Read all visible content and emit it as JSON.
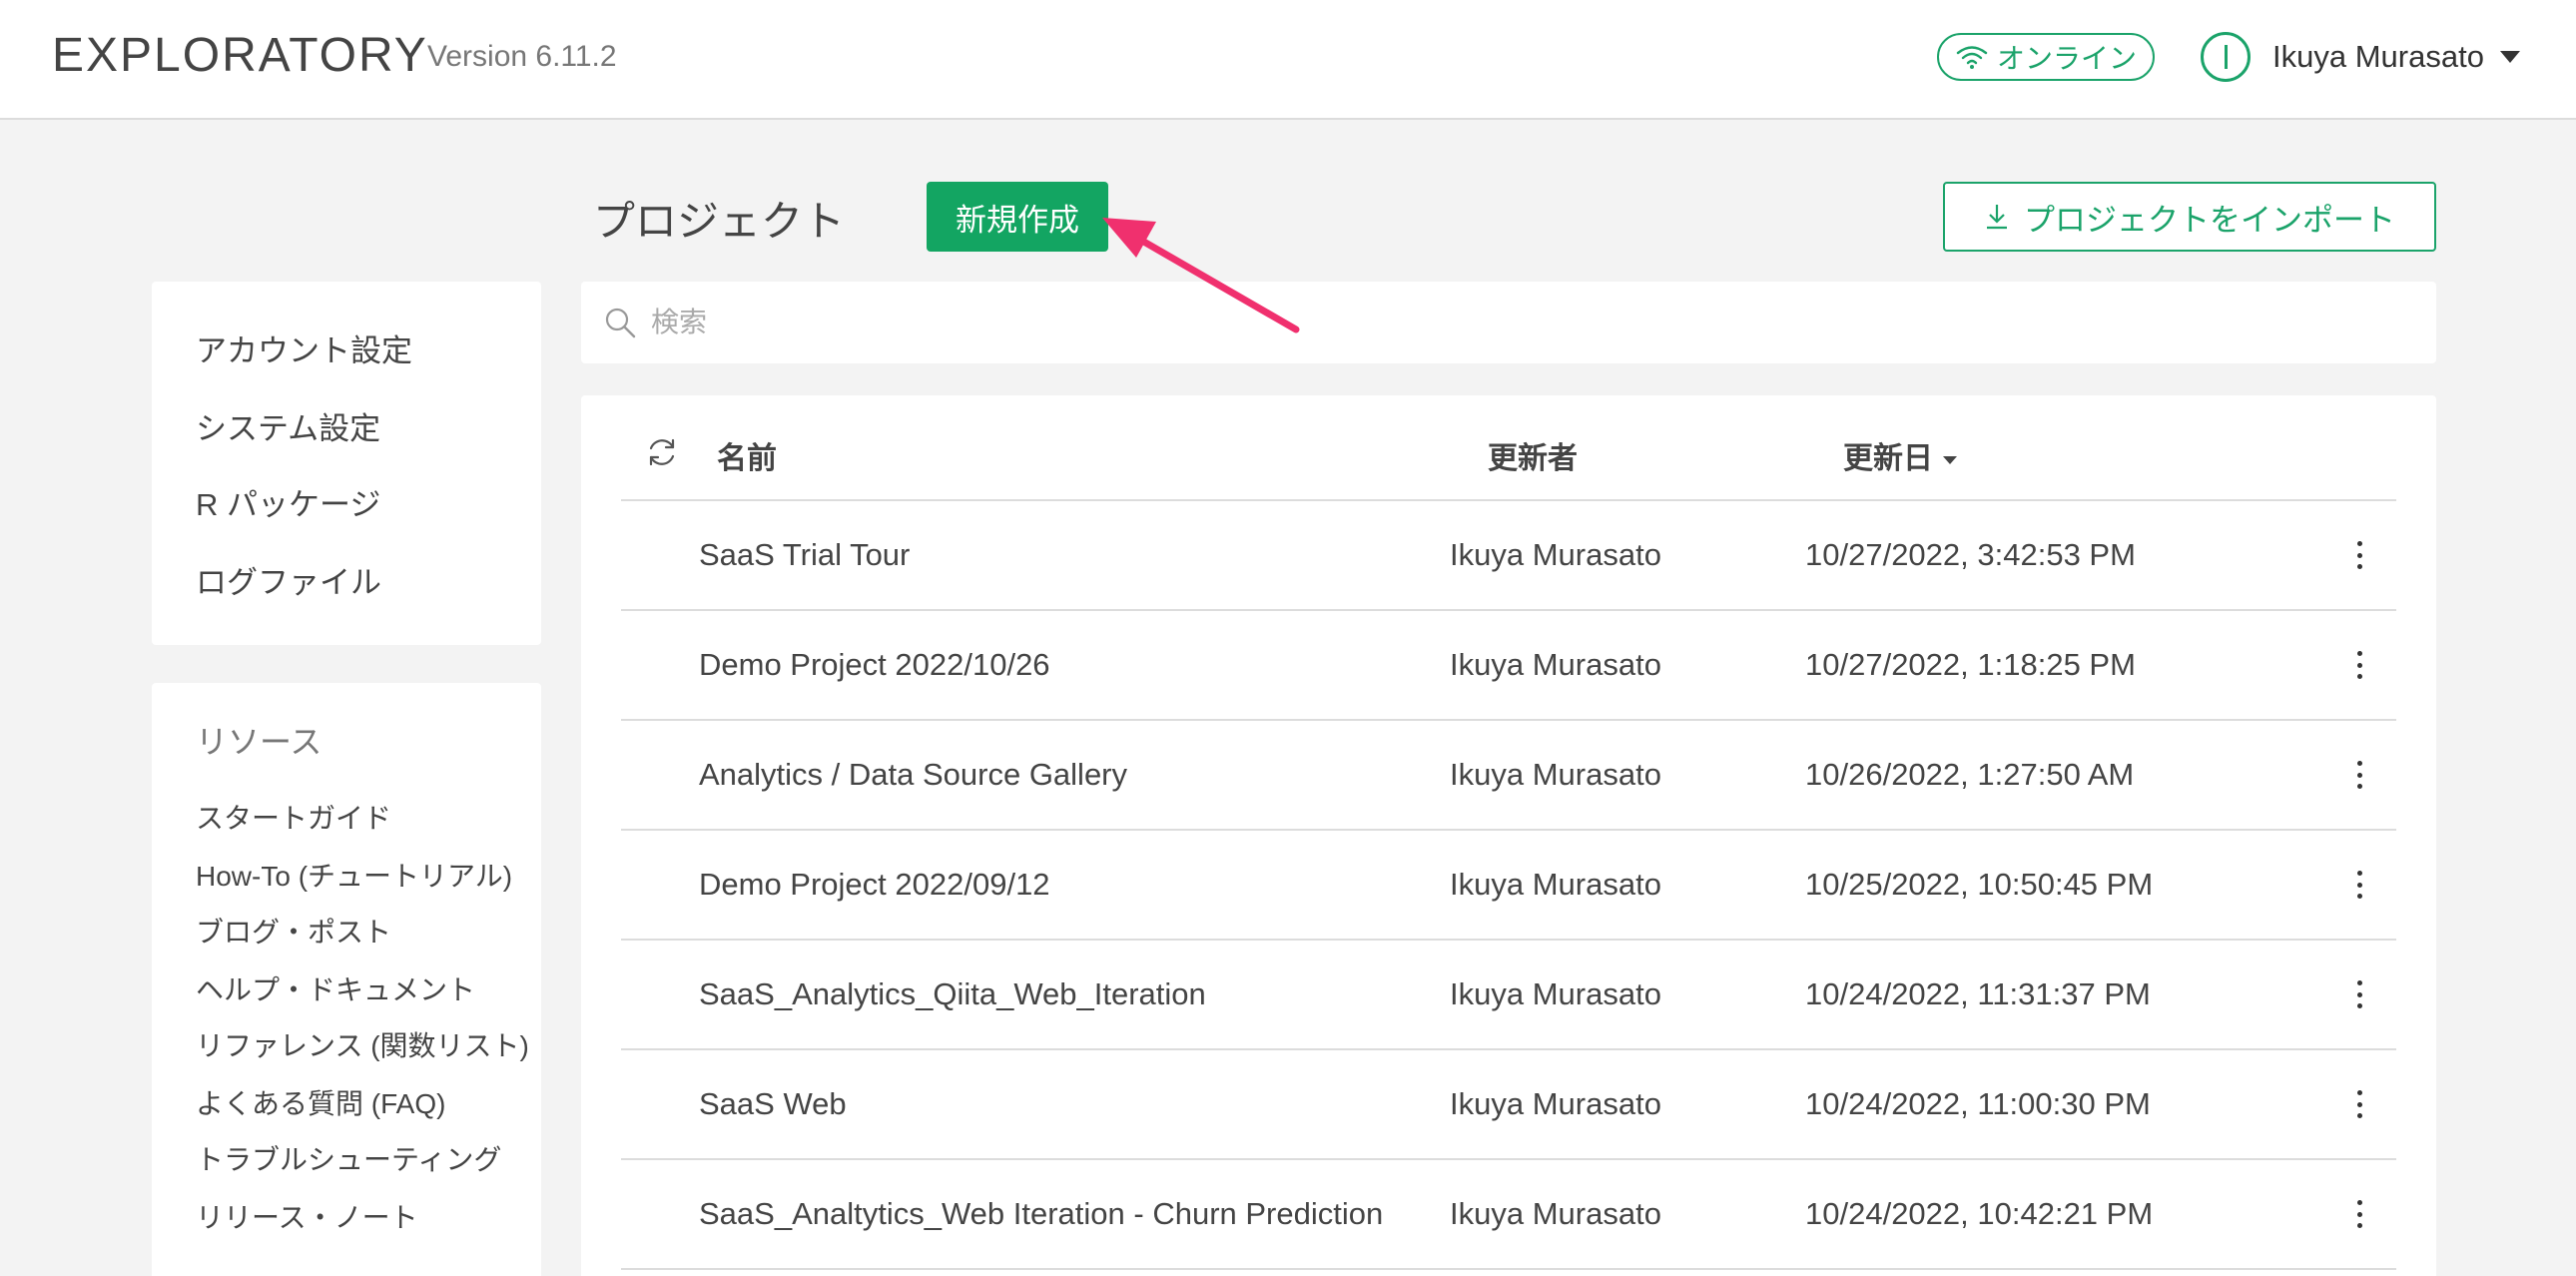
{
  "header": {
    "logo": "EXPLORATORY",
    "version": "Version 6.11.2",
    "online_label": "オンライン",
    "user_name": "Ikuya Murasato"
  },
  "sidebar": {
    "settings": [
      {
        "label": "アカウント設定"
      },
      {
        "label": "システム設定"
      },
      {
        "label": "R パッケージ"
      },
      {
        "label": "ログファイル"
      }
    ],
    "resources_title": "リソース",
    "resources": [
      {
        "label": "スタートガイド"
      },
      {
        "label": "How-To (チュートリアル)"
      },
      {
        "label": "ブログ・ポスト"
      },
      {
        "label": "ヘルプ・ドキュメント"
      },
      {
        "label": "リファレンス (関数リスト)"
      },
      {
        "label": "よくある質問 (FAQ)"
      },
      {
        "label": "トラブルシューティング"
      },
      {
        "label": "リリース・ノート"
      }
    ]
  },
  "main": {
    "title": "プロジェクト",
    "new_button": "新規作成",
    "import_button": "プロジェクトをインポート",
    "search_placeholder": "検索",
    "columns": {
      "name": "名前",
      "updater": "更新者",
      "updated": "更新日"
    },
    "rows": [
      {
        "name": "SaaS Trial Tour",
        "updater": "Ikuya Murasato",
        "updated": "10/27/2022, 3:42:53 PM"
      },
      {
        "name": "Demo Project 2022/10/26",
        "updater": "Ikuya Murasato",
        "updated": "10/27/2022, 1:18:25 PM"
      },
      {
        "name": "Analytics / Data Source Gallery",
        "updater": "Ikuya Murasato",
        "updated": "10/26/2022, 1:27:50 AM"
      },
      {
        "name": "Demo Project 2022/09/12",
        "updater": "Ikuya Murasato",
        "updated": "10/25/2022, 10:50:45 PM"
      },
      {
        "name": "SaaS_Analytics_Qiita_Web_Iteration",
        "updater": "Ikuya Murasato",
        "updated": "10/24/2022, 11:31:37 PM"
      },
      {
        "name": "SaaS Web",
        "updater": "Ikuya Murasato",
        "updated": "10/24/2022, 11:00:30 PM"
      },
      {
        "name": "SaaS_Analtytics_Web Iteration - Churn Prediction",
        "updater": "Ikuya Murasato",
        "updated": "10/24/2022, 10:42:21 PM"
      }
    ]
  },
  "colors": {
    "brand_green": "#13a562",
    "annotation_arrow": "#f0306e"
  }
}
